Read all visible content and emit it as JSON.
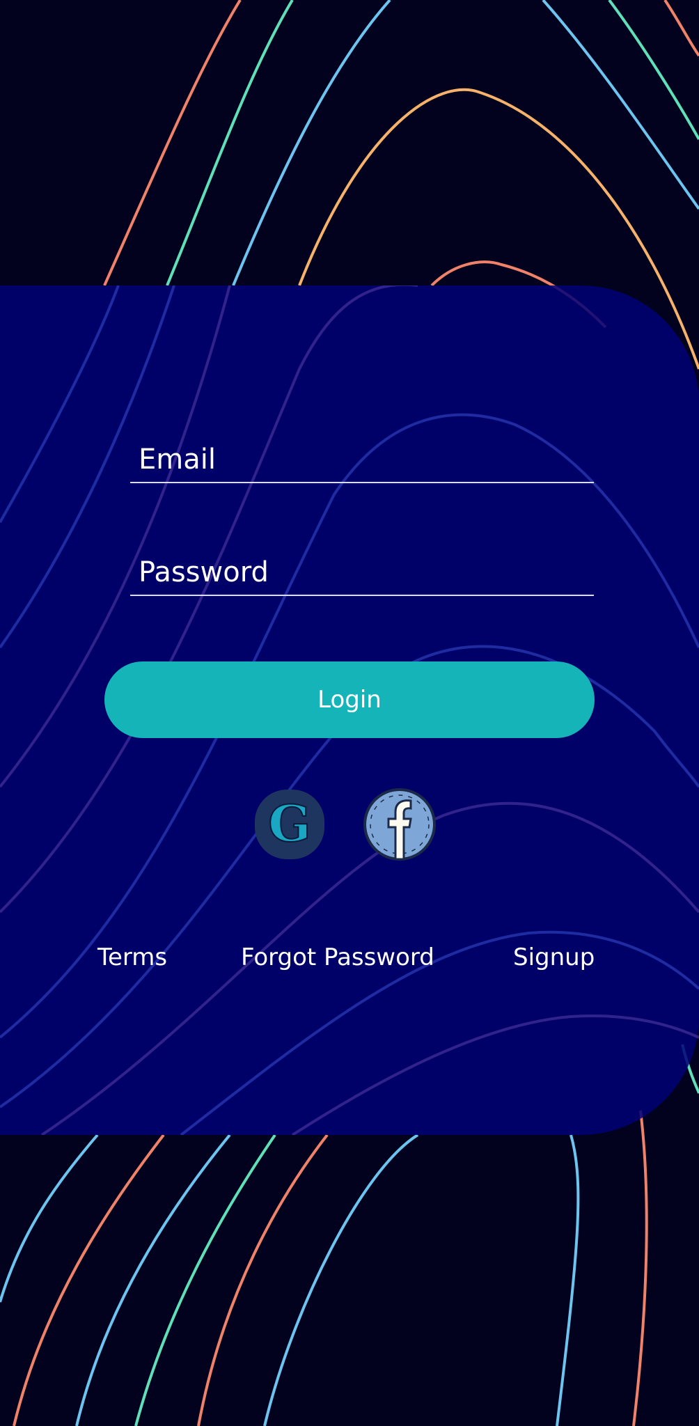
{
  "login_form": {
    "email_placeholder": "Email",
    "password_placeholder": "Password",
    "login_label": "Login"
  },
  "social": {
    "google_icon": "google-icon",
    "facebook_icon": "facebook-icon"
  },
  "footer_links": {
    "terms": "Terms",
    "forgot_password": "Forgot Password",
    "signup": "Signup"
  },
  "colors": {
    "background": "#02021f",
    "panel": "#000076",
    "button": "#14b4b9",
    "line_coral": "#f0826a",
    "line_teal": "#5fe0b8",
    "line_blue": "#6cc4ef",
    "line_orange": "#f6b26b"
  }
}
